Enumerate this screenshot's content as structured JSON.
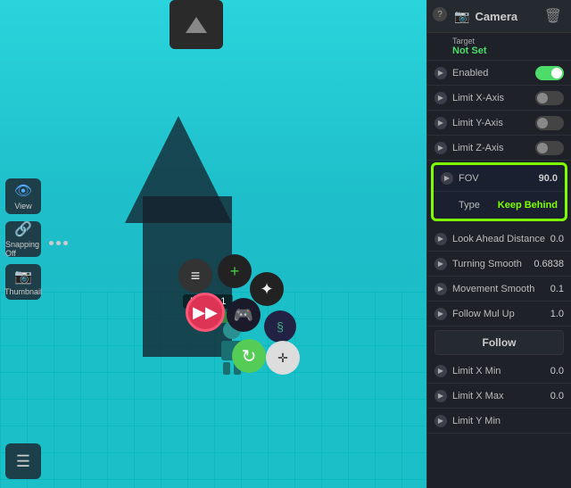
{
  "viewport": {
    "background": "#2ad4dc"
  },
  "left_toolbar": {
    "buttons": [
      {
        "label": "View",
        "icon": "👁"
      },
      {
        "label": "Snapping Off",
        "icon": "🔗"
      },
      {
        "label": "Thumbnail",
        "icon": "📷"
      }
    ]
  },
  "panel": {
    "title": "Camera",
    "title_icon": "📷",
    "delete_label": "🗑",
    "question_icon": "?",
    "properties": [
      {
        "label": "Target",
        "sublabel": "Not Set",
        "sublabel_color": "green",
        "type": "target"
      },
      {
        "label": "Enabled",
        "type": "toggle",
        "value": true
      },
      {
        "label": "Limit X-Axis",
        "type": "toggle",
        "value": false
      },
      {
        "label": "Limit Y-Axis",
        "type": "toggle",
        "value": false
      },
      {
        "label": "Limit Z-Axis",
        "type": "toggle",
        "value": false
      }
    ],
    "highlighted": {
      "fov_label": "FOV",
      "fov_value": "90.0",
      "type_label": "Type",
      "type_value": "Keep Behind"
    },
    "lower_properties": [
      {
        "label": "Look Ahead Distance",
        "value": "0.0"
      },
      {
        "label": "Turning Smooth",
        "value": "0.6838"
      },
      {
        "label": "Movement Smooth",
        "value": "0.1"
      },
      {
        "label": "Follow Mul Up",
        "value": "1.0"
      },
      {
        "label": "Limit X Min",
        "value": "0.0"
      },
      {
        "label": "Limit X Max",
        "value": "0.0"
      },
      {
        "label": "Limit Y Min",
        "value": ""
      }
    ]
  },
  "float_buttons": {
    "menu": "≡",
    "add": "+",
    "bio": "✦",
    "camera": "▶▶",
    "character": "🎮",
    "spiral": "§",
    "refresh": "↻",
    "move": "✛"
  },
  "player_label": "Player 1",
  "follow_label": "Follow"
}
